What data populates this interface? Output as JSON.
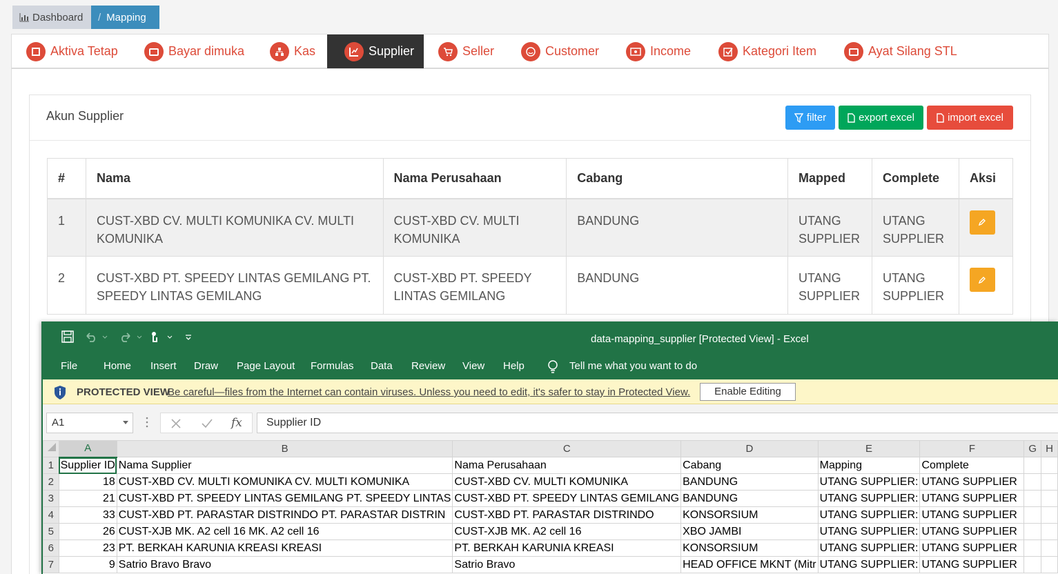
{
  "breadcrumb": {
    "dashboard": "Dashboard",
    "separator": "/",
    "current": "Mapping"
  },
  "tabs": [
    {
      "label": "Aktiva Tetap",
      "icon": "asset-icon"
    },
    {
      "label": "Bayar dimuka",
      "icon": "wallet-icon"
    },
    {
      "label": "Kas",
      "icon": "sitemap-icon"
    },
    {
      "label": "Supplier",
      "icon": "chart-icon",
      "active": true
    },
    {
      "label": "Seller",
      "icon": "cart-icon"
    },
    {
      "label": "Customer",
      "icon": "smile-icon"
    },
    {
      "label": "Income",
      "icon": "money-icon"
    },
    {
      "label": "Kategori Item",
      "icon": "checkbox-icon"
    },
    {
      "label": "Ayat Silang STL",
      "icon": "wallet-icon"
    }
  ],
  "box": {
    "title": "Akun Supplier",
    "filter": "filter",
    "export": "export excel",
    "import": "import excel"
  },
  "table": {
    "headers": [
      "#",
      "Nama",
      "Nama Perusahaan",
      "Cabang",
      "Mapped",
      "Complete",
      "Aksi"
    ],
    "rows": [
      {
        "no": "1",
        "nama": "CUST-XBD CV. MULTI KOMUNIKA CV. MULTI KOMUNIKA",
        "perusahaan": "CUST-XBD CV. MULTI KOMUNIKA",
        "cabang": "BANDUNG",
        "mapped": "UTANG SUPPLIER",
        "complete": "UTANG SUPPLIER"
      },
      {
        "no": "2",
        "nama": "CUST-XBD PT. SPEEDY LINTAS GEMILANG PT. SPEEDY LINTAS GEMILANG",
        "perusahaan": "CUST-XBD PT. SPEEDY LINTAS GEMILANG",
        "cabang": "BANDUNG",
        "mapped": "UTANG SUPPLIER",
        "complete": "UTANG SUPPLIER"
      }
    ]
  },
  "excel": {
    "title": "data-mapping_supplier  [Protected View]  -  Excel",
    "menu": [
      "File",
      "Home",
      "Insert",
      "Draw",
      "Page Layout",
      "Formulas",
      "Data",
      "Review",
      "View",
      "Help",
      "Tell me what you want to do"
    ],
    "protected_label": "PROTECTED VIEW",
    "protected_msg": "Be careful—files from the Internet can contain viruses. Unless you need to edit, it's safer to stay in Protected View.",
    "enable_editing": "Enable Editing",
    "name_box": "A1",
    "formula": "Supplier ID",
    "fx": "fx",
    "columns": [
      "A",
      "B",
      "C",
      "D",
      "E",
      "F",
      "G",
      "H"
    ],
    "rows": [
      {
        "n": "1",
        "cells": [
          "Supplier ID",
          "Nama Supplier",
          "Nama Perusahaan",
          "Cabang",
          "Mapping",
          "Complete",
          "",
          ""
        ]
      },
      {
        "n": "2",
        "cells": [
          "18",
          "CUST-XBD  CV. MULTI KOMUNIKA CV. MULTI KOMUNIKA",
          "CUST-XBD  CV. MULTI KOMUNIKA",
          "BANDUNG",
          "UTANG SUPPLIER:",
          "UTANG SUPPLIER",
          "",
          ""
        ]
      },
      {
        "n": "3",
        "cells": [
          "21",
          "CUST-XBD  PT. SPEEDY LINTAS GEMILANG PT. SPEEDY LINTAS",
          "CUST-XBD  PT. SPEEDY LINTAS GEMILANG",
          "BANDUNG",
          "UTANG SUPPLIER:",
          "UTANG SUPPLIER",
          "",
          ""
        ]
      },
      {
        "n": "4",
        "cells": [
          "33",
          "CUST-XBD PT. PARASTAR DISTRINDO PT. PARASTAR DISTRIN",
          "CUST-XBD PT. PARASTAR DISTRINDO",
          "KONSORSIUM",
          "UTANG SUPPLIER:",
          "UTANG SUPPLIER",
          "",
          ""
        ]
      },
      {
        "n": "5",
        "cells": [
          "26",
          "CUST-XJB MK. A2 cell 16 MK. A2 cell 16",
          "CUST-XJB MK. A2 cell 16",
          "XBO JAMBI",
          "UTANG SUPPLIER:",
          "UTANG SUPPLIER",
          "",
          ""
        ]
      },
      {
        "n": "6",
        "cells": [
          "23",
          "PT. BERKAH KARUNIA KREASI KREASI",
          "PT. BERKAH KARUNIA KREASI",
          "KONSORSIUM",
          "UTANG SUPPLIER:",
          "UTANG SUPPLIER",
          "",
          ""
        ]
      },
      {
        "n": "7",
        "cells": [
          "9",
          "Satrio Bravo Bravo",
          "Satrio Bravo",
          "HEAD OFFICE MKNT (Mitr",
          "UTANG SUPPLIER:",
          "UTANG SUPPLIER",
          "",
          ""
        ]
      }
    ]
  },
  "colors": {
    "accent": "#dd4b39",
    "primary": "#3c8dbc",
    "excel_green": "#217346",
    "warning": "#f5a623"
  }
}
